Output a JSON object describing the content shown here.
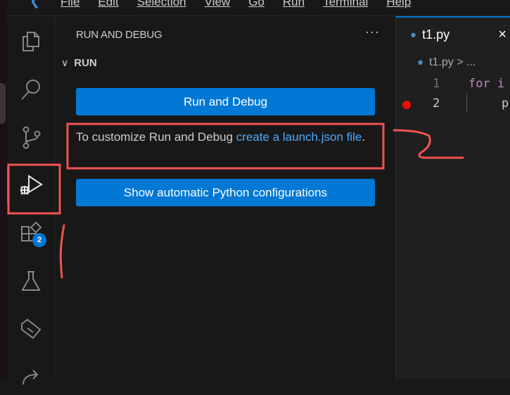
{
  "menu": [
    "File",
    "Edit",
    "Selection",
    "View",
    "Go",
    "Run",
    "Terminal",
    "Help"
  ],
  "activity": {
    "extensions_badge": "2"
  },
  "sidebar": {
    "title": "RUN AND DEBUG",
    "more": "···",
    "section": "RUN",
    "run_button": "Run and Debug",
    "desc_prefix": "To customize Run and Debug ",
    "desc_link": "create a launch.json file",
    "desc_suffix": ".",
    "python_button": "Show automatic Python configurations"
  },
  "editor": {
    "tab": "t1.py",
    "close": "×",
    "breadcrumb": "t1.py > ...",
    "lines": [
      {
        "n": "1",
        "code": "for i"
      },
      {
        "n": "2",
        "code": "p"
      }
    ]
  },
  "annotation": {
    "color": "#ef5350"
  }
}
